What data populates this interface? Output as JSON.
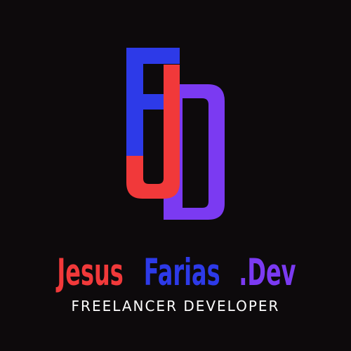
{
  "logo": {
    "monogram": "FJD",
    "wordmark": {
      "part1": "Jesus",
      "part2": "Farias",
      "part3": ".Dev"
    },
    "tagline": "FREELANCER DEVELOPER"
  },
  "colors": {
    "background": "#0d0a0c",
    "red": "#f1393a",
    "blue": "#2d3ae8",
    "purple": "#7b3af2",
    "tagline": "#ffffff"
  }
}
